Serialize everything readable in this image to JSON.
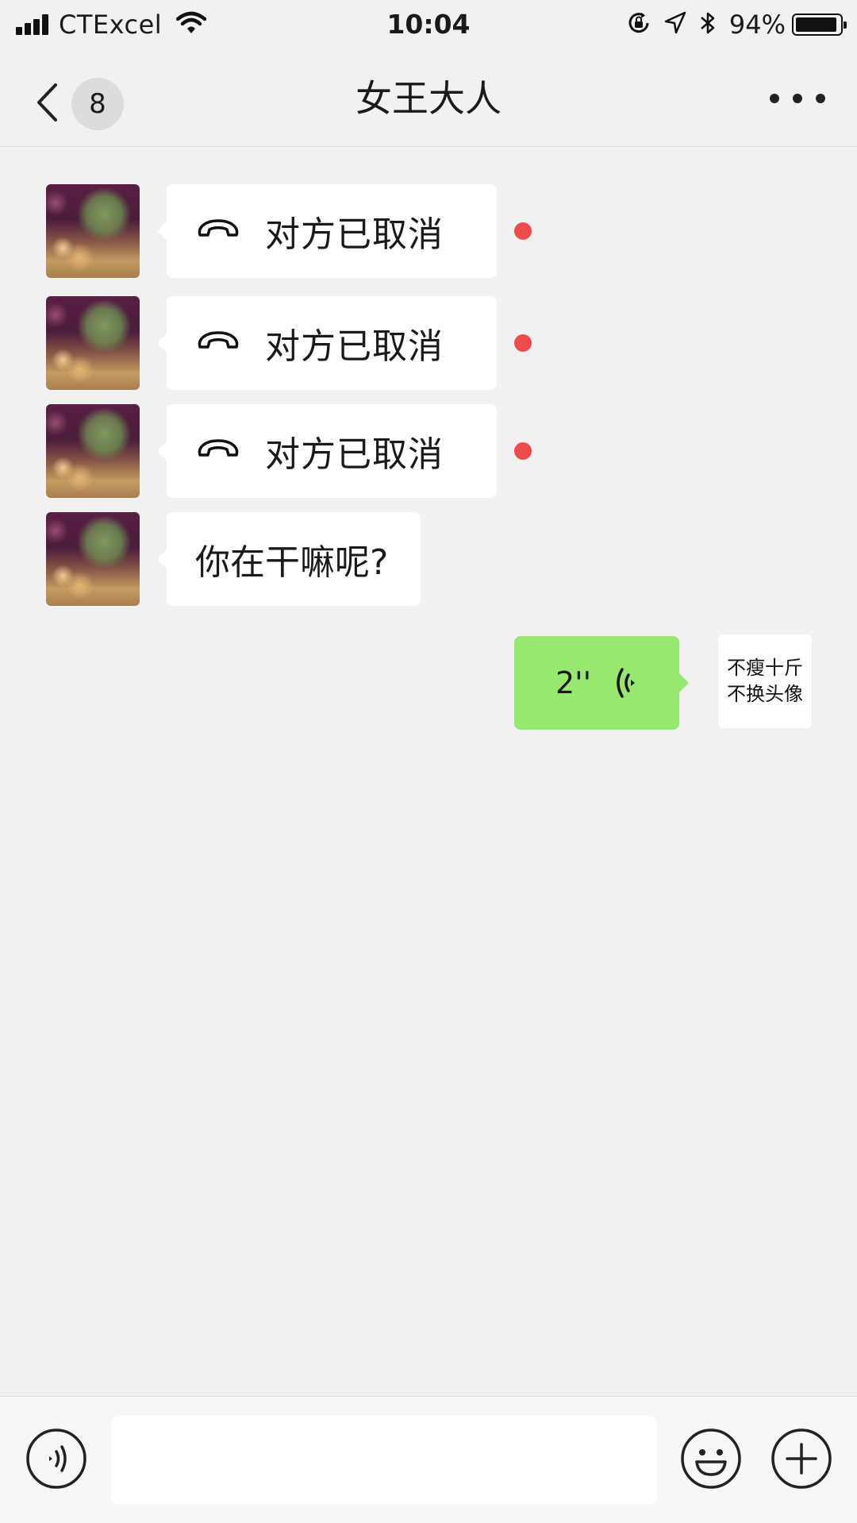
{
  "status_bar": {
    "carrier": "CTExcel",
    "time": "10:04",
    "battery_percent": "94%",
    "battery_level": 0.94,
    "icons": [
      "signal-icon",
      "wifi-icon",
      "orientation-lock-icon",
      "location-icon",
      "bluetooth-icon",
      "battery-icon"
    ]
  },
  "nav": {
    "back_icon": "chevron-left-icon",
    "unread_count": "8",
    "title": "女王大人",
    "more_icon": "more-icon"
  },
  "messages": [
    {
      "side": "left",
      "type": "call",
      "icon": "phone-hangup-icon",
      "text": "对方已取消",
      "unread_dot": true
    },
    {
      "side": "left",
      "type": "call",
      "icon": "phone-hangup-icon",
      "text": "对方已取消",
      "unread_dot": true
    },
    {
      "side": "left",
      "type": "call",
      "icon": "phone-hangup-icon",
      "text": "对方已取消",
      "unread_dot": true
    },
    {
      "side": "left",
      "type": "text",
      "text": "你在干嘛呢?"
    },
    {
      "side": "right",
      "type": "voice",
      "duration": "2''",
      "icon": "voice-wave-icon"
    }
  ],
  "my_avatar": {
    "line1": "不瘦十斤",
    "line2": "不换头像"
  },
  "input_bar": {
    "voice_icon": "voice-input-icon",
    "input_value": "",
    "emoji_icon": "emoji-icon",
    "plus_icon": "plus-icon"
  },
  "colors": {
    "background": "#f1f1f1",
    "bubble_in": "#ffffff",
    "bubble_out": "#96e86f",
    "unread_dot": "#ee4b4b"
  }
}
